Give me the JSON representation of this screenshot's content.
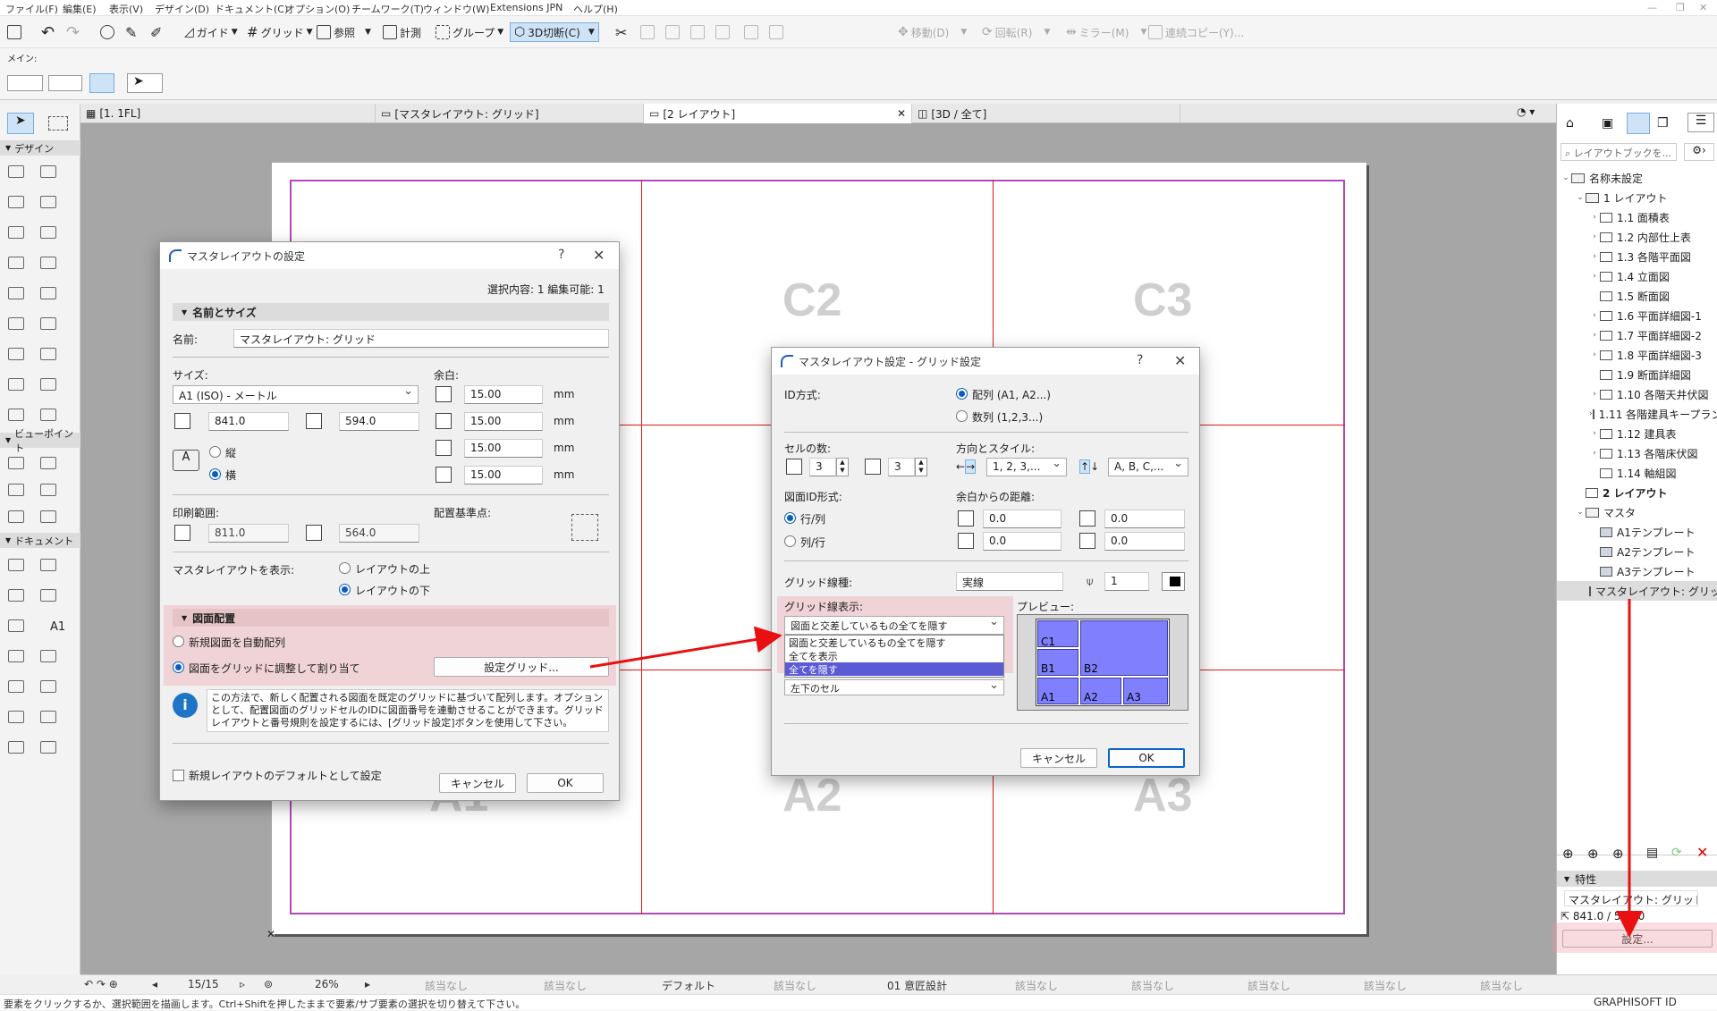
{
  "menubar": {
    "items": [
      "ファイル(F)",
      "編集(E)",
      "表示(V)",
      "デザイン(D)",
      "ドキュメント(C)",
      "オプション(O)",
      "チームワーク(T)",
      "ウィンドウ(W)",
      "Extensions JPN",
      "ヘルプ(H)"
    ]
  },
  "toolbar": {
    "guide": "ガイド",
    "grid": "グリッド",
    "reference": "参照",
    "measure": "計測",
    "group": "グループ",
    "cut3d": "3D切断(C)",
    "move": "移動(D)",
    "rotate": "回転(R)",
    "mirror": "ミラー(M)",
    "multicopy": "連続コピー(Y)..."
  },
  "infobar": {
    "label": "メイン:"
  },
  "tabs": [
    "[1. 1FL]",
    "[マスタレイアウト: グリッド]",
    "[2 レイアウト]",
    "[3D / 全て]"
  ],
  "lefttools": {
    "design": "デザイン",
    "viewpoint": "ビューポイント",
    "document": "ドキュメント",
    "a1": "A1"
  },
  "sheet": {
    "labels": [
      "C2",
      "C3",
      "A1",
      "A2",
      "A3"
    ]
  },
  "dialog_master": {
    "title": "マスタレイアウトの設定",
    "help": "?",
    "close": "✕",
    "selection_info": "選択内容: 1 編集可能: 1",
    "section_name_size": "名前とサイズ",
    "name_label": "名前:",
    "name_value": "マスタレイアウト: グリッド",
    "size_label": "サイズ:",
    "size_value": "A1 (ISO) - メートル",
    "width": "841.0",
    "height": "594.0",
    "orient_portrait": "縦",
    "orient_landscape": "横",
    "margin_label": "余白:",
    "margins": [
      "15.00",
      "15.00",
      "15.00",
      "15.00"
    ],
    "unit": "mm",
    "print_area_label": "印刷範囲:",
    "print_w": "811.0",
    "print_h": "564.0",
    "anchor_label": "配置基準点:",
    "show_master_label": "マスタレイアウトを表示:",
    "show_above": "レイアウトの上",
    "show_below": "レイアウトの下",
    "section_drawing": "図面配置",
    "auto_arrange": "新規図面を自動配列",
    "fit_grid": "図面をグリッドに調整して割り当て",
    "grid_settings_button": "設定グリッド...",
    "info_text": "この方法で、新しく配置される図面を既定のグリッドに基づいて配列します。オプションとして、配置図面のグリッドセルのIDに図面番号を連動させることができます。グリッドレイアウトと番号規則を設定するには、[グリッド設定]ボタンを使用して下さい。",
    "default_checkbox": "新規レイアウトのデフォルトとして設定",
    "cancel": "キャンセル",
    "ok": "OK",
    "info_icon": "i"
  },
  "dialog_grid": {
    "title": "マスタレイアウト設定 - グリッド設定",
    "help": "?",
    "close": "✕",
    "id_method_label": "ID方式:",
    "id_array": "配列 (A1, A2...)",
    "id_numeric": "数列 (1,2,3...)",
    "cell_count_label": "セルの数:",
    "cols": "3",
    "rows": "3",
    "direction_label": "方向とスタイル:",
    "h_style": "1, 2, 3,...",
    "v_style": "A, B, C,...",
    "id_format_label": "図面ID形式:",
    "row_col": "行/列",
    "col_row": "列/行",
    "margin_distance_label": "余白からの距離:",
    "distances": [
      "0.0",
      "0.0",
      "0.0",
      "0.0"
    ],
    "gridline_label": "グリッド線種:",
    "gridline_value": "実線",
    "pen_value": "1",
    "gridline_display_label": "グリッド線表示:",
    "gridline_display_value": "図面と交差しているもの全てを隠す",
    "dropdown_options": [
      "図面と交差しているもの全てを隠す",
      "全てを表示",
      "全てを隠す"
    ],
    "dropdown_highlight_index": 2,
    "anchor_value": "左下のセル",
    "preview_label": "プレビュー:",
    "preview_cells": [
      "C1",
      "B1",
      "B2",
      "A1",
      "A2",
      "A3"
    ],
    "cancel": "キャンセル",
    "ok": "OK"
  },
  "navigator": {
    "search_placeholder": "レイアウトブックを...",
    "items": [
      {
        "label": "名称未設定",
        "kind": "book",
        "level": 0,
        "chev": "⌄"
      },
      {
        "label": "1 レイアウト",
        "kind": "folder",
        "level": 1,
        "chev": "⌄"
      },
      {
        "label": "1.1 面積表",
        "kind": "page",
        "level": 2,
        "chev": "›"
      },
      {
        "label": "1.2 内部仕上表",
        "kind": "page",
        "level": 2,
        "chev": "›"
      },
      {
        "label": "1.3 各階平面図",
        "kind": "page",
        "level": 2,
        "chev": "›"
      },
      {
        "label": "1.4 立面図",
        "kind": "page",
        "level": 2,
        "chev": "›"
      },
      {
        "label": "1.5 断面図",
        "kind": "page",
        "level": 2,
        "chev": ""
      },
      {
        "label": "1.6 平面詳細図-1",
        "kind": "page",
        "level": 2,
        "chev": "›"
      },
      {
        "label": "1.7 平面詳細図-2",
        "kind": "page",
        "level": 2,
        "chev": "›"
      },
      {
        "label": "1.8 平面詳細図-3",
        "kind": "page",
        "level": 2,
        "chev": "›"
      },
      {
        "label": "1.9 断面詳細図",
        "kind": "page",
        "level": 2,
        "chev": ""
      },
      {
        "label": "1.10 各階天井伏図",
        "kind": "page",
        "level": 2,
        "chev": "›"
      },
      {
        "label": "1.11 各階建具キープラン",
        "kind": "page",
        "level": 2,
        "chev": "›"
      },
      {
        "label": "1.12 建具表",
        "kind": "page",
        "level": 2,
        "chev": "›"
      },
      {
        "label": "1.13 各階床伏図",
        "kind": "page",
        "level": 2,
        "chev": "›"
      },
      {
        "label": "1.14 軸組図",
        "kind": "page",
        "level": 2,
        "chev": ""
      },
      {
        "label": "2 レイアウト",
        "kind": "page",
        "level": 1,
        "chev": "",
        "bold": true
      },
      {
        "label": "マスタ",
        "kind": "folder",
        "level": 1,
        "chev": "⌄"
      },
      {
        "label": "A1テンプレート",
        "kind": "master",
        "level": 2,
        "chev": ""
      },
      {
        "label": "A2テンプレート",
        "kind": "master",
        "level": 2,
        "chev": ""
      },
      {
        "label": "A3テンプレート",
        "kind": "master",
        "level": 2,
        "chev": ""
      },
      {
        "label": "マスタレイアウト: グリッド",
        "kind": "master",
        "level": 2,
        "chev": "",
        "selected": true
      }
    ],
    "properties_label": "特性",
    "prop_name": "マスタレイアウト: グリッド",
    "prop_size": "841.0 / 594.0",
    "settings_button": "設定..."
  },
  "statusbar": {
    "fraction": "15/15",
    "zoom": "26%",
    "na": "該当なし",
    "default": "デフォルト",
    "design": "01 意匠設計"
  },
  "bottombar": {
    "hint": "要素をクリックするか、選択範囲を描画します。Ctrl+Shiftを押したままで要素/サブ要素の選択を切り替えて下さい。",
    "brand": "GRAPHISOFT ID"
  },
  "colors": {
    "grid_line": "#e01818",
    "frame": "#b04ab8",
    "arrow": "#e81010",
    "preview_cell": "#8080ff",
    "accent": "#0a5cc2"
  }
}
